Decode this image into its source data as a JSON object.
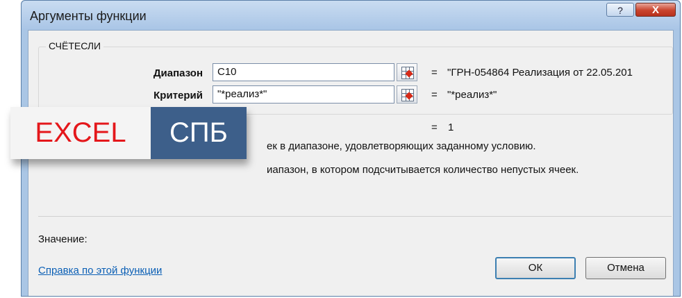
{
  "window": {
    "title": "Аргументы функции",
    "help_glyph": "?",
    "close_glyph": "X"
  },
  "function": {
    "name": "СЧЁТЕСЛИ",
    "args": [
      {
        "label": "Диапазон",
        "value": "C10",
        "result": "\"ГРН-054864 Реализация от 22.05.201"
      },
      {
        "label": "Критерий",
        "value": "\"*реализ*\"",
        "result": "\"*реализ*\""
      }
    ],
    "eq_sign": "=",
    "total_result": "1",
    "description": "ек в диапазоне, удовлетворяющих заданному условию.",
    "arg_description": "иапазон, в котором подсчитывается количество непустых ячеек."
  },
  "watermark": {
    "left_text": "EXCEL",
    "right_text": "СПБ"
  },
  "footer": {
    "value_label": "Значение:",
    "help_link": "Справка по этой функции",
    "ok_label": "ОК",
    "cancel_label": "Отмена"
  },
  "colors": {
    "window_frame": "#aac6e5",
    "close_button": "#c9432d",
    "link": "#0b5fb5",
    "watermark_red": "#e4171b",
    "watermark_blue": "#3d5f8a"
  },
  "icons": {
    "ref_button": "collapse-dialog-icon"
  }
}
